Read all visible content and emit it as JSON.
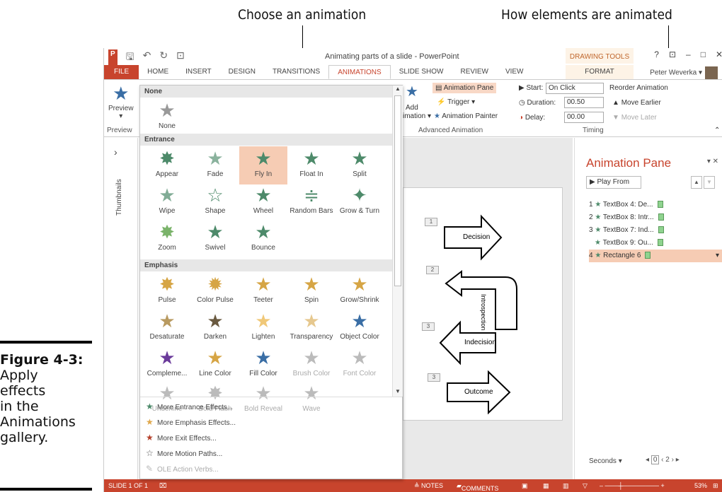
{
  "callouts": {
    "left": "Choose an animation",
    "right": "How elements are animated"
  },
  "caption": {
    "label": "Figure 4-3:",
    "text": [
      "Apply",
      "effects",
      "in the",
      "Animations",
      "gallery."
    ]
  },
  "titlebar": {
    "title": "Animating parts of a slide - PowerPoint",
    "context": "DRAWING TOOLS",
    "controls": [
      "?",
      "⊡",
      "–",
      "□",
      "✕"
    ]
  },
  "tabs": [
    "FILE",
    "HOME",
    "INSERT",
    "DESIGN",
    "TRANSITIONS",
    "ANIMATIONS",
    "SLIDE SHOW",
    "REVIEW",
    "VIEW"
  ],
  "format_tab": "FORMAT",
  "user": "Peter Weverka",
  "ribbon": {
    "preview": "Preview",
    "preview_group": "Preview",
    "add_animation": "Add",
    "add_animation2": "imation ▾",
    "animation_pane": "Animation Pane",
    "trigger": "Trigger ▾",
    "animation_painter": "Animation Painter",
    "adv_group": "Advanced Animation",
    "start_label": "Start:",
    "start_value": "On Click",
    "duration_label": "Duration:",
    "duration_value": "00.50",
    "delay_label": "Delay:",
    "delay_value": "00.00",
    "reorder": "Reorder Animation",
    "move_earlier": "Move Earlier",
    "move_later": "Move Later",
    "timing_group": "Timing"
  },
  "leftpane": {
    "label": "Thumbnails",
    "chev": "›"
  },
  "gallery": {
    "none_header": "None",
    "none_label": "None",
    "entrance_header": "Entrance",
    "entrance": [
      "Appear",
      "Fade",
      "Fly In",
      "Float In",
      "Split",
      "Wipe",
      "Shape",
      "Wheel",
      "Random Bars",
      "Grow & Turn",
      "Zoom",
      "Swivel",
      "Bounce"
    ],
    "emphasis_header": "Emphasis",
    "emphasis": [
      "Pulse",
      "Color Pulse",
      "Teeter",
      "Spin",
      "Grow/Shrink",
      "Desaturate",
      "Darken",
      "Lighten",
      "Transparency",
      "Object Color",
      "Compleme...",
      "Line Color",
      "Fill Color",
      "Brush Color",
      "Font Color",
      "Underline",
      "Bold Flash",
      "Bold Reveal",
      "Wave"
    ],
    "more": [
      "More Entrance Effects...",
      "More Emphasis Effects...",
      "More Exit Effects...",
      "More Motion Paths...",
      "OLE Action Verbs..."
    ]
  },
  "slide": {
    "shapes": [
      "Decision",
      "Introspection",
      "Indecision",
      "Outcome"
    ],
    "tags": [
      "1",
      "2",
      "3",
      "3"
    ]
  },
  "anim_pane": {
    "title": "Animation Pane",
    "play_from": "Play From",
    "rows": [
      {
        "num": "1",
        "name": "TextBox 4: De..."
      },
      {
        "num": "2",
        "name": "TextBox 8: Intr..."
      },
      {
        "num": "3",
        "name": "TextBox 7: Ind..."
      },
      {
        "num": "",
        "name": "TextBox 9: Ou..."
      },
      {
        "num": "4",
        "name": "Rectangle 6"
      }
    ],
    "seconds": "Seconds ▾",
    "zoom_vals": [
      "0",
      "2"
    ]
  },
  "status": {
    "slide": "SLIDE 1 OF 1",
    "notes": "≜ NOTES",
    "comments": "COMMENTS",
    "zoom": "53%"
  }
}
